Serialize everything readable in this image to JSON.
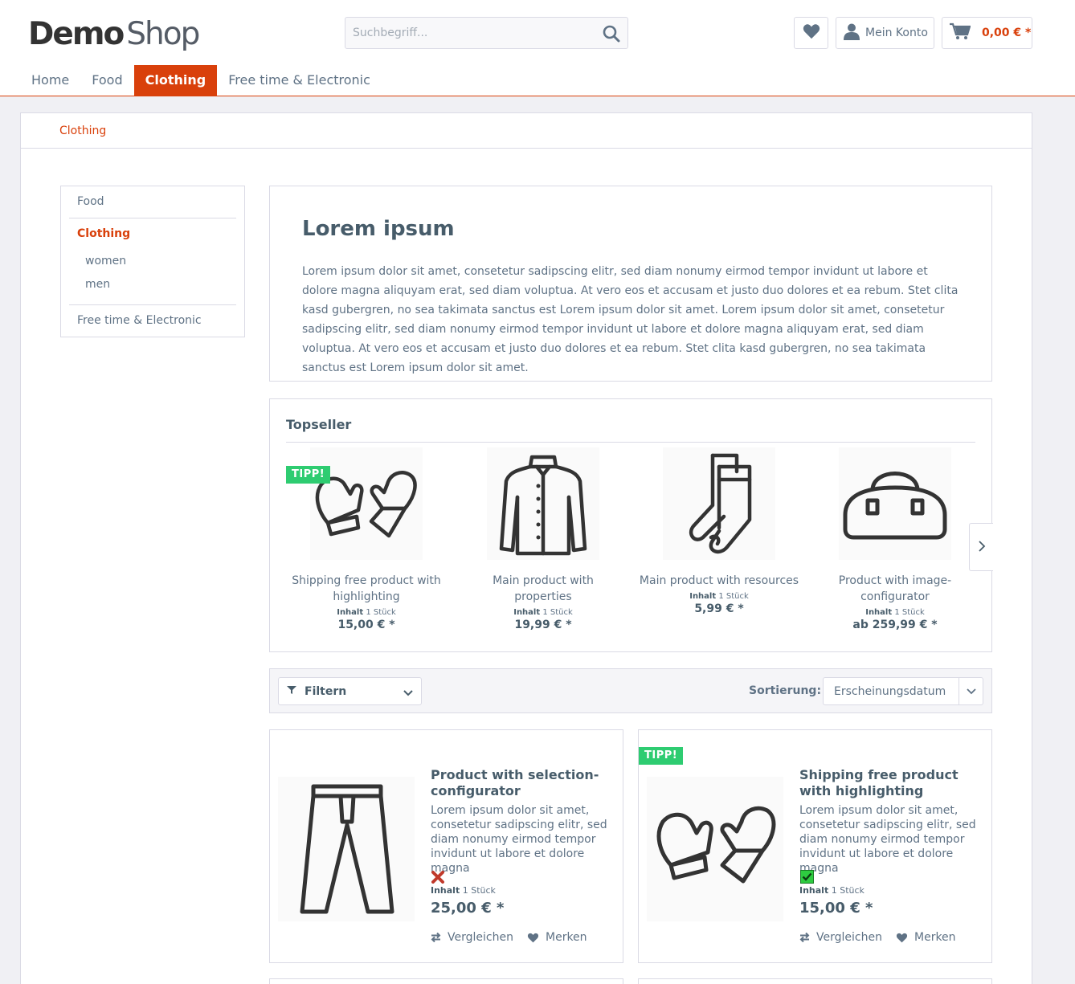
{
  "header": {
    "logo_bold": "Demo",
    "logo_light": "Shop",
    "search_placeholder": "Suchbegriff...",
    "account_label": "Mein Konto",
    "cart_total": "0,00 € *"
  },
  "nav": [
    {
      "label": "Home"
    },
    {
      "label": "Food"
    },
    {
      "label": "Clothing"
    },
    {
      "label": "Free time & Electronic"
    }
  ],
  "breadcrumb": "Clothing",
  "sidebar": {
    "categories": [
      "Food",
      "Clothing",
      "Free time & Electronic"
    ],
    "subcategories": [
      "women",
      "men"
    ]
  },
  "intro": {
    "title": "Lorem ipsum",
    "text": "Lorem ipsum dolor sit amet, consetetur sadipscing elitr, sed diam nonumy eirmod tempor invidunt ut labore et dolore magna aliquyam erat, sed diam voluptua. At vero eos et accusam et justo duo dolores et ea rebum. Stet clita kasd gubergren, no sea takimata sanctus est Lorem ipsum dolor sit amet. Lorem ipsum dolor sit amet, consetetur sadipscing elitr, sed diam nonumy eirmod tempor invidunt ut labore et dolore magna aliquyam erat, sed diam voluptua. At vero eos et accusam et justo duo dolores et ea rebum. Stet clita kasd gubergren, no sea takimata sanctus est Lorem ipsum dolor sit amet."
  },
  "topseller": {
    "title": "Topseller",
    "badge": "TIPP!",
    "content_label": "Inhalt",
    "items": [
      {
        "name": "Shipping free product with highlighting",
        "content": "1 Stück",
        "price": "15,00 € *",
        "icon": "mittens-icon"
      },
      {
        "name": "Main product with properties",
        "content": "1 Stück",
        "price": "19,99 € *",
        "icon": "jacket-icon"
      },
      {
        "name": "Main product with resources",
        "content": "1 Stück",
        "price": "5,99 € *",
        "icon": "socks-icon"
      },
      {
        "name": "Product with image-configurator",
        "content": "1 Stück",
        "price": "ab 259,99 € *",
        "icon": "bag-icon"
      }
    ]
  },
  "listing": {
    "filter_label": "Filtern",
    "sort_label": "Sortierung:",
    "sort_value": "Erscheinungsdatum",
    "compare_label": "Vergleichen",
    "wishlist_label": "Merken",
    "content_label": "Inhalt",
    "badge": "TIPP!",
    "products": [
      {
        "title": "Product with selection-configurator",
        "description": "Lorem ipsum dolor sit amet, consetetur sadipscing elitr, sed diam nonumy eirmod tempor invidunt ut labore et dolore magna",
        "content": "1 Stück",
        "price": "25,00 € *",
        "available": false,
        "icon": "pants-icon"
      },
      {
        "title": "Shipping free product with highlighting",
        "description": "Lorem ipsum dolor sit amet, consetetur sadipscing elitr, sed diam nonumy eirmod tempor invidunt ut labore et dolore magna",
        "content": "1 Stück",
        "price": "15,00 € *",
        "available": true,
        "icon": "mittens-icon"
      }
    ]
  },
  "colors": {
    "accent": "#d9400b",
    "text": "#5f7285",
    "heading": "#475c6a",
    "badge": "#2ecc71",
    "border": "#dadae5",
    "page_bg": "#f0f0f4"
  }
}
